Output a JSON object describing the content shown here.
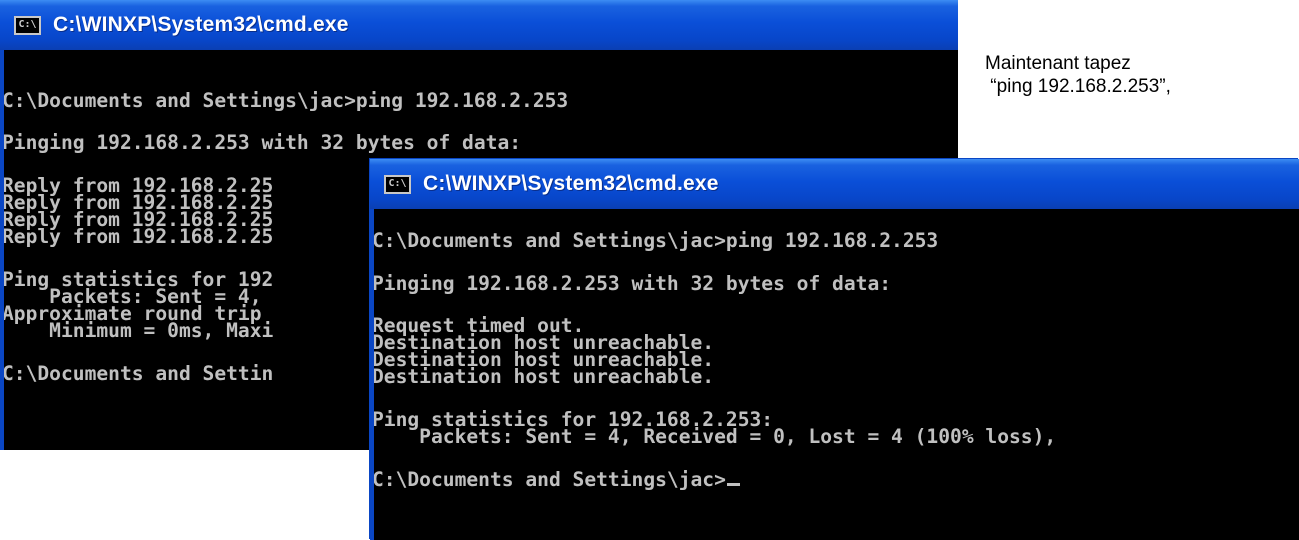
{
  "windows": {
    "back": {
      "title": "C:\\WINXP\\System32\\cmd.exe",
      "icon": "cmd-icon",
      "lines": [
        "C:\\Documents and Settings\\jac>ping 192.168.2.253",
        "Pinging 192.168.2.253 with 32 bytes of data:",
        "Reply from 192.168.2.25",
        "Reply from 192.168.2.25",
        "Reply from 192.168.2.25",
        "Reply from 192.168.2.25",
        "Ping statistics for 192",
        "    Packets: Sent = 4,",
        "Approximate round trip",
        "    Minimum = 0ms, Maxi",
        "C:\\Documents and Settin"
      ]
    },
    "front": {
      "title": "C:\\WINXP\\System32\\cmd.exe",
      "icon": "cmd-icon",
      "lines": [
        "C:\\Documents and Settings\\jac>ping 192.168.2.253",
        "Pinging 192.168.2.253 with 32 bytes of data:",
        "Request timed out.",
        "Destination host unreachable.",
        "Destination host unreachable.",
        "Destination host unreachable.",
        "Ping statistics for 192.168.2.253:",
        "    Packets: Sent = 4, Received = 0, Lost = 4 (100% loss),",
        "C:\\Documents and Settings\\jac>"
      ]
    }
  },
  "caption": {
    "line1": "Maintenant tapez",
    "line2": " “ping 192.168.2.253”,"
  },
  "colors": {
    "titlebar": "#0a4fd8",
    "console_bg": "#000000",
    "console_text": "#c0c0c0"
  }
}
